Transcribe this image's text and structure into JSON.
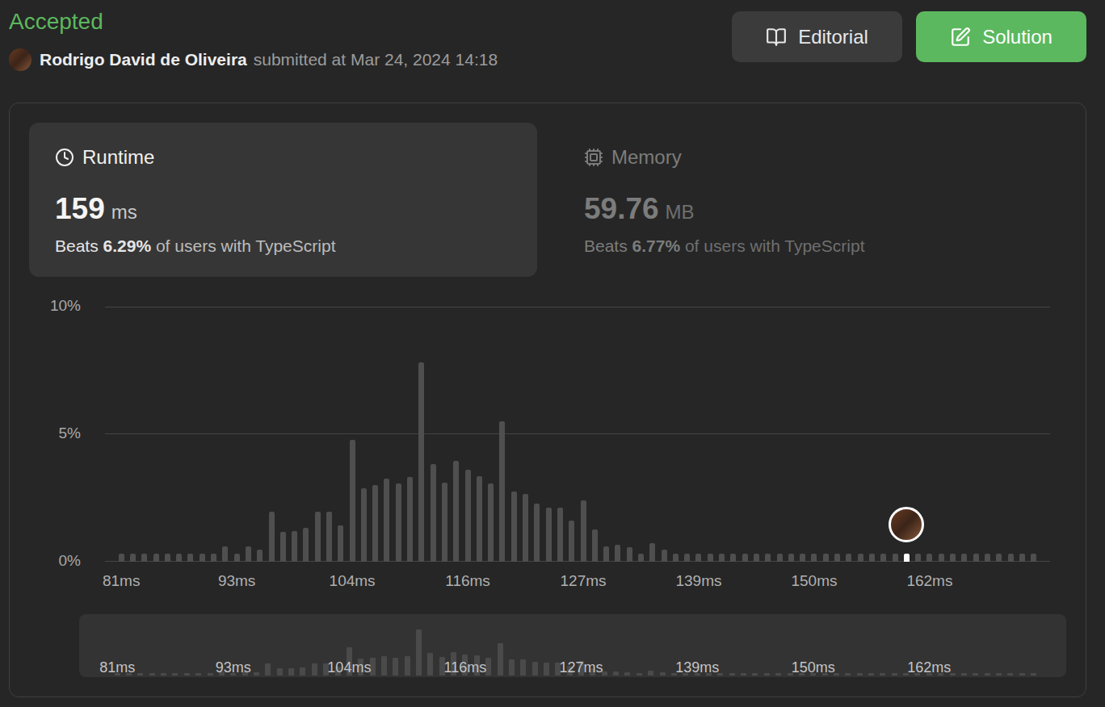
{
  "status": "Accepted",
  "submission": {
    "author": "Rodrigo David de Oliveira",
    "submitted_text": "submitted at Mar 24, 2024 14:18"
  },
  "buttons": [
    {
      "label": "Editorial",
      "kind": "editorial"
    },
    {
      "label": "Solution",
      "kind": "solution"
    }
  ],
  "metrics": [
    {
      "kind": "runtime",
      "title": "Runtime",
      "value": "159",
      "unit": "ms",
      "beats_prefix": "Beats",
      "beats": "6.29%",
      "beats_suffix": "of users with TypeScript",
      "selected": true
    },
    {
      "kind": "memory",
      "title": "Memory",
      "value": "59.76",
      "unit": "MB",
      "beats_prefix": "Beats",
      "beats": "6.77%",
      "beats_suffix": "of users with TypeScript",
      "selected": false
    }
  ],
  "chart": {
    "y_ticks": [
      "10%",
      "5%",
      "0%"
    ],
    "x_ticks": [
      "81ms",
      "93ms",
      "104ms",
      "116ms",
      "127ms",
      "139ms",
      "150ms",
      "162ms"
    ],
    "values": [
      0.3,
      0.3,
      0.3,
      0.3,
      0.3,
      0.3,
      0.3,
      0.3,
      0.3,
      0.6,
      0.3,
      0.6,
      0.45,
      1.95,
      1.15,
      1.2,
      1.3,
      1.95,
      1.95,
      1.4,
      4.75,
      2.85,
      3.0,
      3.25,
      3.05,
      3.3,
      7.8,
      3.8,
      3.1,
      3.95,
      3.6,
      3.35,
      3.05,
      5.5,
      2.75,
      2.65,
      2.25,
      2.1,
      2.1,
      1.6,
      2.4,
      1.25,
      0.6,
      0.65,
      0.55,
      0.3,
      0.7,
      0.45,
      0.3,
      0.3,
      0.3,
      0.3,
      0.3,
      0.3,
      0.3,
      0.3,
      0.3,
      0.3,
      0.3,
      0.3,
      0.3,
      0.3,
      0.3,
      0.3,
      0.3,
      0.3,
      0.3,
      0.3,
      0.3,
      0.3,
      0.3,
      0.3,
      0.3,
      0.3,
      0.3,
      0.3,
      0.3,
      0.3,
      0.3,
      0.3
    ],
    "your_index": 68
  }
}
